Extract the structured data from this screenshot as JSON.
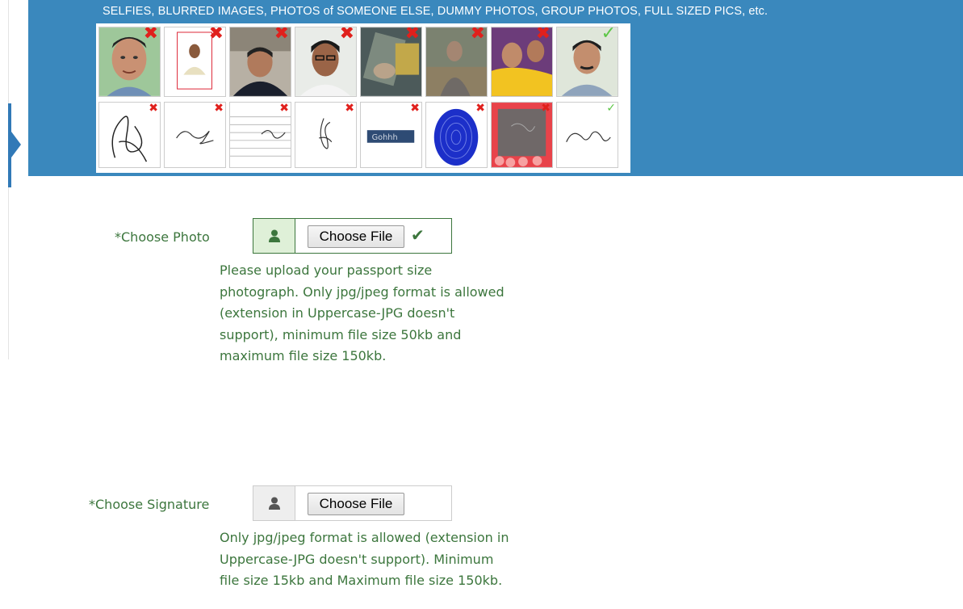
{
  "banner": {
    "text": "SELFIES, BLURRED IMAGES, PHOTOS of SOMEONE ELSE, DUMMY PHOTOS, GROUP PHOTOS, FULL SIZED PICS, etc.",
    "photo_examples": [
      {
        "kind": "selfie",
        "mark": "✖",
        "valid": false
      },
      {
        "kind": "full-sized-pic",
        "mark": "✖",
        "valid": false
      },
      {
        "kind": "dark-photo",
        "mark": "✖",
        "valid": false
      },
      {
        "kind": "someone-else",
        "mark": "✖",
        "valid": false
      },
      {
        "kind": "blurred-image",
        "mark": "✖",
        "valid": false
      },
      {
        "kind": "blurred-person",
        "mark": "✖",
        "valid": false
      },
      {
        "kind": "group-photo",
        "mark": "✖",
        "valid": false
      },
      {
        "kind": "valid-passport-photo",
        "mark": "✓",
        "valid": true
      }
    ],
    "signature_examples": [
      {
        "kind": "large-signature",
        "mark": "✖",
        "valid": false
      },
      {
        "kind": "small-signature",
        "mark": "✖",
        "valid": false
      },
      {
        "kind": "lined-paper-signature",
        "mark": "✖",
        "valid": false
      },
      {
        "kind": "vertical-signature",
        "mark": "✖",
        "valid": false
      },
      {
        "kind": "stamped-signature",
        "mark": "✖",
        "valid": false
      },
      {
        "kind": "thumbprint",
        "mark": "✖",
        "valid": false
      },
      {
        "kind": "decorative-background",
        "mark": "✖",
        "valid": false
      },
      {
        "kind": "valid-signature",
        "mark": "✓",
        "valid": true
      }
    ]
  },
  "photo": {
    "label": "*Choose Photo",
    "button": "Choose File",
    "status_icon": "check-icon",
    "help": "Please upload your passport size photograph. Only jpg/jpeg format is allowed (extension in Uppercase-JPG doesn't support), minimum file size 50kb and maximum file size 150kb."
  },
  "signature": {
    "label": "*Choose Signature",
    "button": "Choose File",
    "help": "Only jpg/jpeg format is allowed (extension in Uppercase-JPG doesn't support). Minimum file size 15kb and Maximum file size 150kb."
  },
  "colors": {
    "banner": "#3a88bd",
    "success_text": "#3c763d",
    "success_bg": "#dff0d8",
    "invalid_mark": "#e0201c",
    "valid_mark": "#5cc646"
  }
}
